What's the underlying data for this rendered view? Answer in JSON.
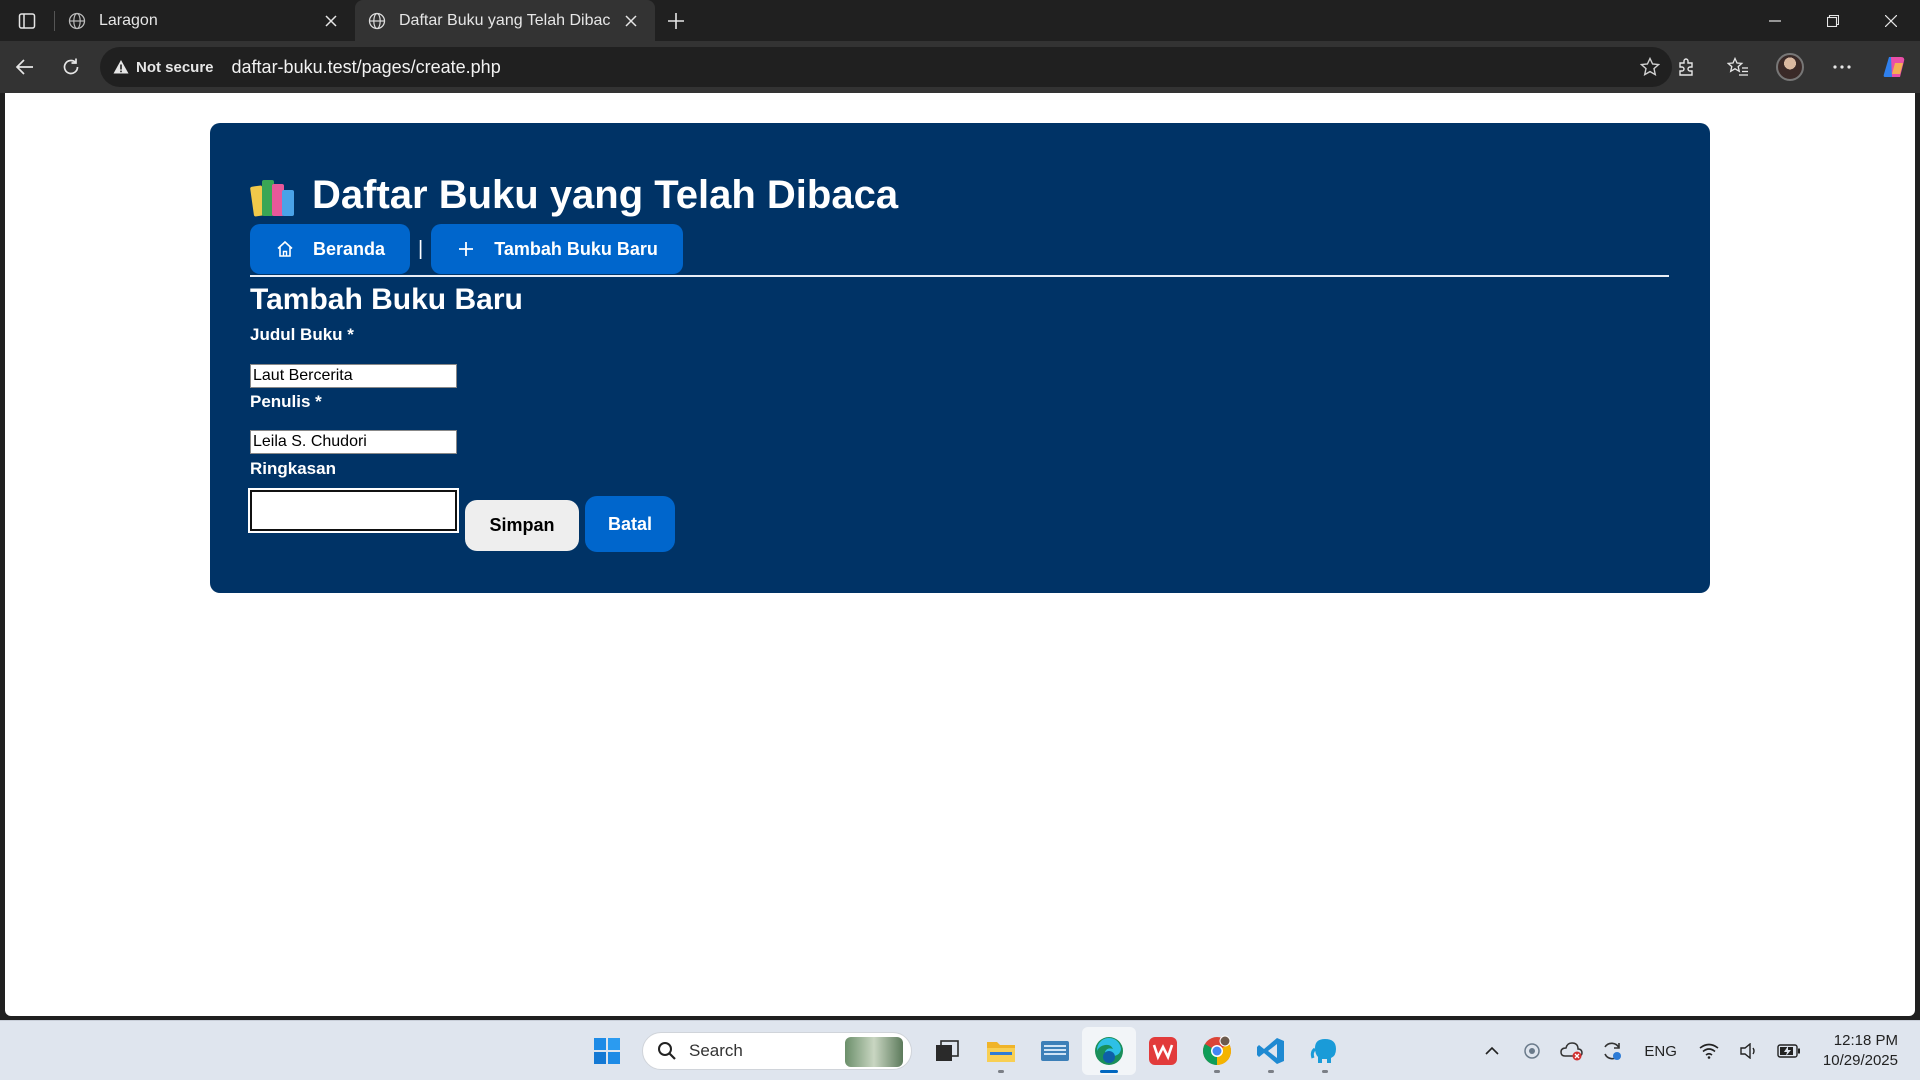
{
  "browser": {
    "tabs": [
      {
        "title": "Laragon",
        "active": false
      },
      {
        "title": "Daftar Buku yang Telah Dibaca",
        "active": true
      }
    ],
    "security_label": "Not secure",
    "url": "daftar-buku.test/pages/create.php"
  },
  "page": {
    "title": "Daftar Buku yang Telah Dibaca",
    "nav": {
      "home_label": "Beranda",
      "separator": "|",
      "add_label": "Tambah Buku Baru"
    },
    "form": {
      "heading": "Tambah Buku Baru",
      "title_label": "Judul Buku *",
      "title_value": "Laut Bercerita",
      "author_label": "Penulis *",
      "author_value": "Leila S. Chudori",
      "summary_label": "Ringkasan",
      "summary_value": "",
      "save_label": "Simpan",
      "cancel_label": "Batal"
    },
    "colors": {
      "card": "#003366",
      "accent": "#0066cc"
    }
  },
  "taskbar": {
    "search_placeholder": "Search",
    "language": "ENG",
    "time": "12:18 PM",
    "date": "10/29/2025"
  }
}
